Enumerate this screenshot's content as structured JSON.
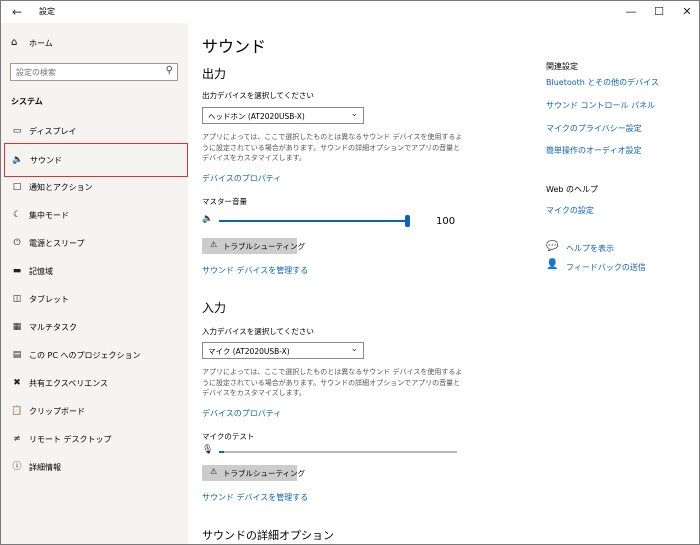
{
  "window": {
    "app_title": "設定",
    "back_icon": "back-arrow-icon",
    "minimize": "—",
    "maximize": "☐",
    "close": "✕"
  },
  "sidebar": {
    "home_label": "ホーム",
    "search_placeholder": "設定の検索",
    "section_title": "システム",
    "items": [
      {
        "label": "ディスプレイ",
        "icon": "display-icon"
      },
      {
        "label": "サウンド",
        "icon": "speaker-icon",
        "selected": true
      },
      {
        "label": "通知とアクション",
        "icon": "notification-icon"
      },
      {
        "label": "集中モード",
        "icon": "moon-icon"
      },
      {
        "label": "電源とスリープ",
        "icon": "power-icon"
      },
      {
        "label": "記憶域",
        "icon": "storage-icon"
      },
      {
        "label": "タブレット",
        "icon": "tablet-icon"
      },
      {
        "label": "マルチタスク",
        "icon": "multitask-icon"
      },
      {
        "label": "この PC へのプロジェクション",
        "icon": "projection-icon"
      },
      {
        "label": "共有エクスペリエンス",
        "icon": "shared-icon"
      },
      {
        "label": "クリップボード",
        "icon": "clipboard-icon"
      },
      {
        "label": "リモート デスクトップ",
        "icon": "remote-desktop-icon"
      },
      {
        "label": "詳細情報",
        "icon": "info-icon"
      }
    ]
  },
  "main": {
    "title": "サウンド",
    "output": {
      "heading": "出力",
      "device_label": "出力デバイスを選択してください",
      "device_value": "ヘッドホン (AT2020USB-X)",
      "description": "アプリによっては、ここで選択したものとは異なるサウンド デバイスを使用するように設定されている場合があります。サウンドの詳細オプションでアプリの音量とデバイスをカスタマイズします。",
      "properties_link": "デバイスのプロパティ",
      "master_volume_label": "マスター音量",
      "volume_value": "100",
      "volume_fraction": 1.0,
      "troubleshoot_label": "トラブルシューティング",
      "manage_link": "サウンド デバイスを管理する"
    },
    "input": {
      "heading": "入力",
      "device_label": "入力デバイスを選択してください",
      "device_value": "マイク (AT2020USB-X)",
      "description": "アプリによっては、ここで選択したものとは異なるサウンド デバイスを使用するように設定されている場合があります。サウンドの詳細オプションでアプリの音量とデバイスをカスタマイズします。",
      "properties_link": "デバイスのプロパティ",
      "mic_test_label": "マイクのテスト",
      "mic_level_fraction": 0.02,
      "troubleshoot_label": "トラブルシューティング",
      "manage_link": "サウンド デバイスを管理する"
    },
    "advanced_heading": "サウンドの詳細オプション"
  },
  "related": {
    "heading": "関連設定",
    "links": [
      "Bluetooth とその他のデバイス",
      "サウンド コントロール パネル",
      "マイクのプライバシー設定",
      "簡単操作のオーディオ設定"
    ],
    "web_help_heading": "Web のヘルプ",
    "web_help_link": "マイクの設定",
    "help_link": "ヘルプを表示",
    "feedback_link": "フィードバックの送信"
  },
  "colors": {
    "accent": "#0b63b8",
    "sidebar_bg": "#f5f4f1",
    "selection_border": "#e0303a",
    "button_bg": "#cccccc"
  }
}
